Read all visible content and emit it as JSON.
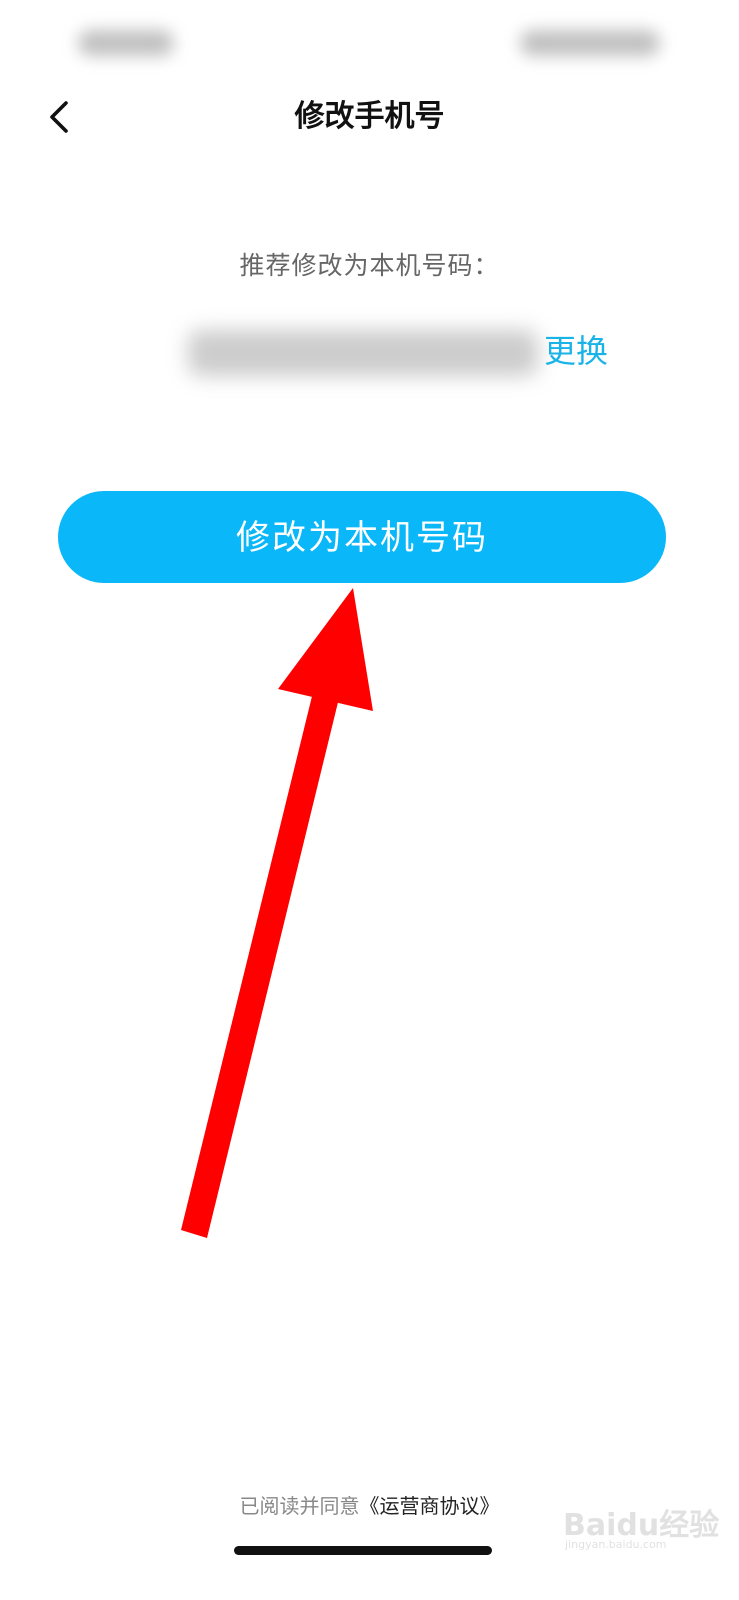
{
  "header": {
    "title": "修改手机号"
  },
  "main": {
    "recommend_label": "推荐修改为本机号码：",
    "change_label": "更换",
    "primary_button_label": "修改为本机号码"
  },
  "footer": {
    "agreement_prefix": "已阅读并同意",
    "agreement_link": "《运营商协议》"
  },
  "watermark": {
    "text": "Baidu经验",
    "sub": "jingyan.baidu.com"
  },
  "icons": {
    "back": "chevron-left-icon",
    "annotation": "red-arrow"
  },
  "colors": {
    "accent": "#0ab7f8",
    "link": "#1ab3e8",
    "annotation": "#ff0000"
  }
}
